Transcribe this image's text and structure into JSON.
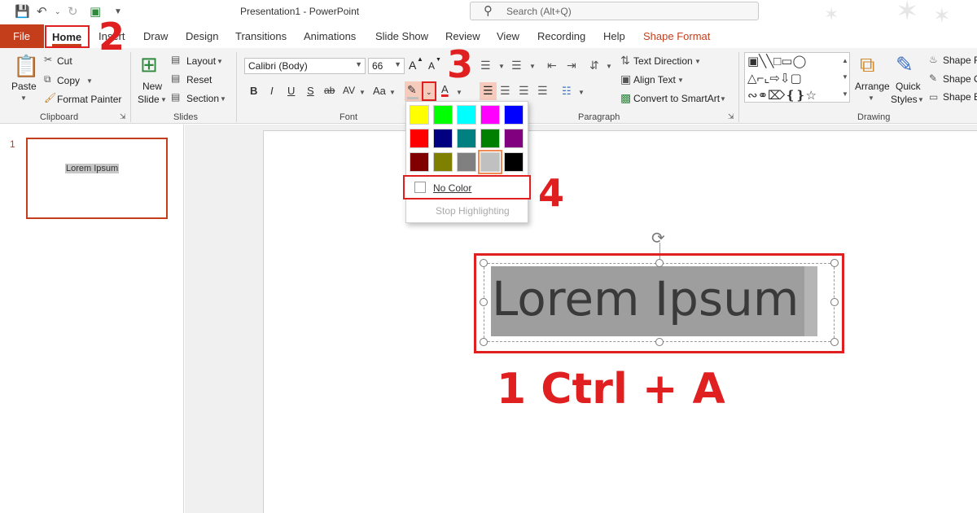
{
  "titlebar": {
    "title": "Presentation1  -  PowerPoint",
    "search_placeholder": "Search (Alt+Q)"
  },
  "tabs": {
    "file": "File",
    "home": "Home",
    "insert": "Insert",
    "draw": "Draw",
    "design": "Design",
    "transitions": "Transitions",
    "animations": "Animations",
    "slideshow": "Slide Show",
    "review": "Review",
    "view": "View",
    "recording": "Recording",
    "help": "Help",
    "shape_format": "Shape Format"
  },
  "clipboard": {
    "paste": "Paste",
    "cut": "Cut",
    "copy": "Copy",
    "format_painter": "Format Painter",
    "group": "Clipboard"
  },
  "slides": {
    "new": "New",
    "slide": "Slide",
    "layout": "Layout",
    "reset": "Reset",
    "section": "Section",
    "group": "Slides"
  },
  "font": {
    "name": "Calibri (Body)",
    "size": "66",
    "grow": "A",
    "shrink": "A",
    "bold": "B",
    "italic": "I",
    "underline": "U",
    "shadow": "S",
    "strike": "ab",
    "spacing": "AV",
    "case": "Aa",
    "color_a": "A",
    "group": "Font"
  },
  "paragraph": {
    "text_direction": "Text Direction",
    "align_text": "Align Text",
    "smartart": "Convert to SmartArt",
    "group": "Paragraph"
  },
  "drawing": {
    "arrange": "Arrange",
    "quick": "Quick",
    "styles": "Styles",
    "shape_fill": "Shape Fi",
    "shape_outline": "Shape O",
    "shape_effects": "Shape E",
    "group": "Drawing"
  },
  "highlight_menu": {
    "colors": [
      "#ffff00",
      "#00ff00",
      "#00ffff",
      "#ff00ff",
      "#0000ff",
      "#ff0000",
      "#000080",
      "#008080",
      "#008000",
      "#800080",
      "#800000",
      "#808000",
      "#808080",
      "#c0c0c0",
      "#000000"
    ],
    "selected_index": 13,
    "no_color": "No Color",
    "stop": "Stop Highlighting"
  },
  "thumbnail": {
    "number": "1",
    "text": "Lorem Ipsum"
  },
  "slide_text": "Lorem Ipsum",
  "annotations": {
    "step1": "1 Ctrl + A",
    "step2": "2",
    "step3": "3",
    "step4": "4"
  }
}
